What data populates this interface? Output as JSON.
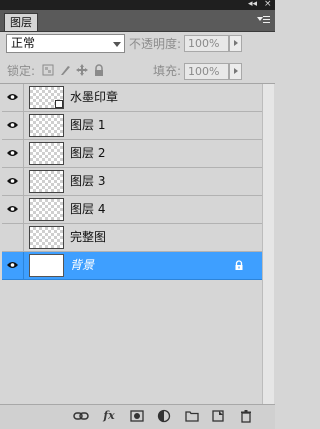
{
  "window": {
    "collapse_glyph": "◂◂",
    "close_glyph": "×"
  },
  "panel": {
    "tab_label": "图层",
    "menu_icon": "panel-menu-icon"
  },
  "blend": {
    "mode": "正常",
    "opacity_label": "不透明度:",
    "opacity_value": "100%"
  },
  "locks": {
    "lock_label": "锁定:",
    "fill_label": "填充:",
    "fill_value": "100%",
    "icons": [
      "lock-transparent-pixels-icon",
      "lock-image-pixels-icon",
      "lock-position-icon",
      "lock-all-icon"
    ]
  },
  "layers": [
    {
      "name": "水墨印章",
      "visible": true,
      "selected": false,
      "thumb": "transparent-with-badge"
    },
    {
      "name": "图层 1",
      "visible": true,
      "selected": false,
      "thumb": "transparent"
    },
    {
      "name": "图层 2",
      "visible": true,
      "selected": false,
      "thumb": "transparent"
    },
    {
      "name": "图层 3",
      "visible": true,
      "selected": false,
      "thumb": "transparent"
    },
    {
      "name": "图层 4",
      "visible": true,
      "selected": false,
      "thumb": "transparent"
    },
    {
      "name": "完整图",
      "visible": false,
      "selected": false,
      "thumb": "transparent"
    },
    {
      "name": "背景",
      "visible": true,
      "selected": true,
      "thumb": "white",
      "locked": true
    }
  ],
  "bottom_icons": [
    "link-layers-icon",
    "fx-icon",
    "layer-mask-icon",
    "adjustment-layer-icon",
    "new-group-icon",
    "new-layer-icon",
    "delete-layer-icon"
  ],
  "colors": {
    "selected": "#3e9fff",
    "panel_bg": "#d6d6d6",
    "tabbar": "#5a5a5a"
  }
}
